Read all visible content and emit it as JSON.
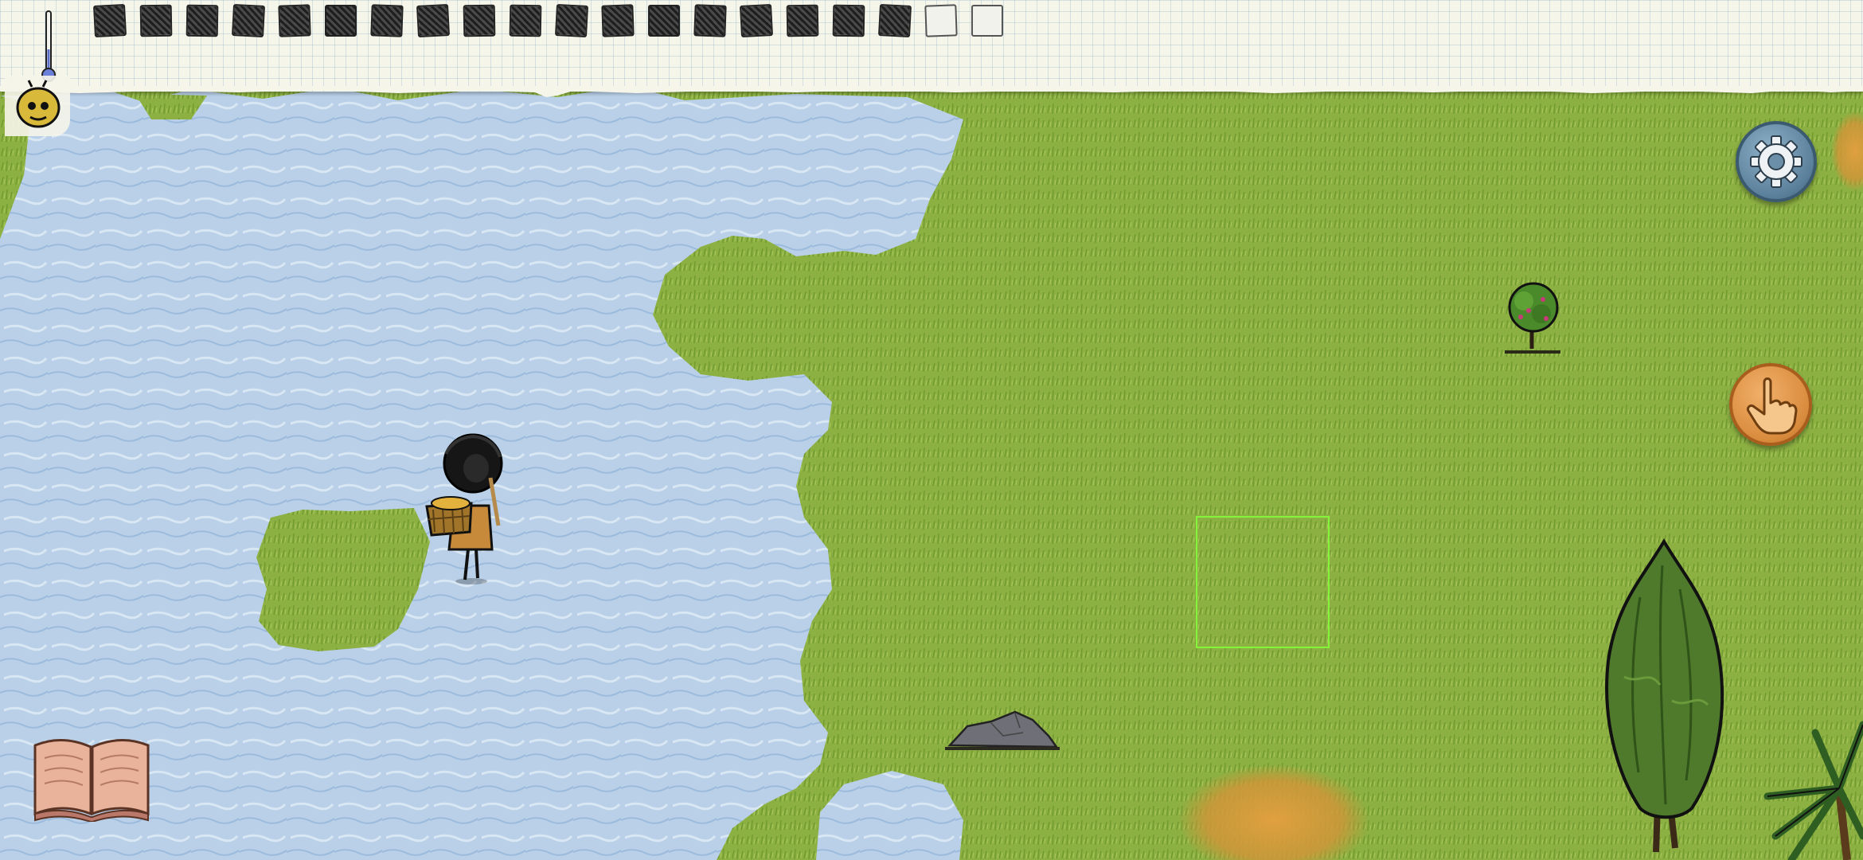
{
  "hud": {
    "hunger_pips_total": 20,
    "hunger_pips_filled": 18,
    "thermometer_level": 0.05
  },
  "colors": {
    "water": "#b5cde6",
    "grass": "#8db043",
    "dry_grass": "#d79a3a",
    "target_outline": "#84f53a",
    "settings_button": "#6b8fa8",
    "interact_button": "#d88b3d"
  },
  "icons": {
    "settings": "gear-icon",
    "interact": "hand-pointer-icon",
    "journal": "open-book-icon",
    "temperature": "thermometer-icon",
    "portrait": "character-face-icon"
  }
}
